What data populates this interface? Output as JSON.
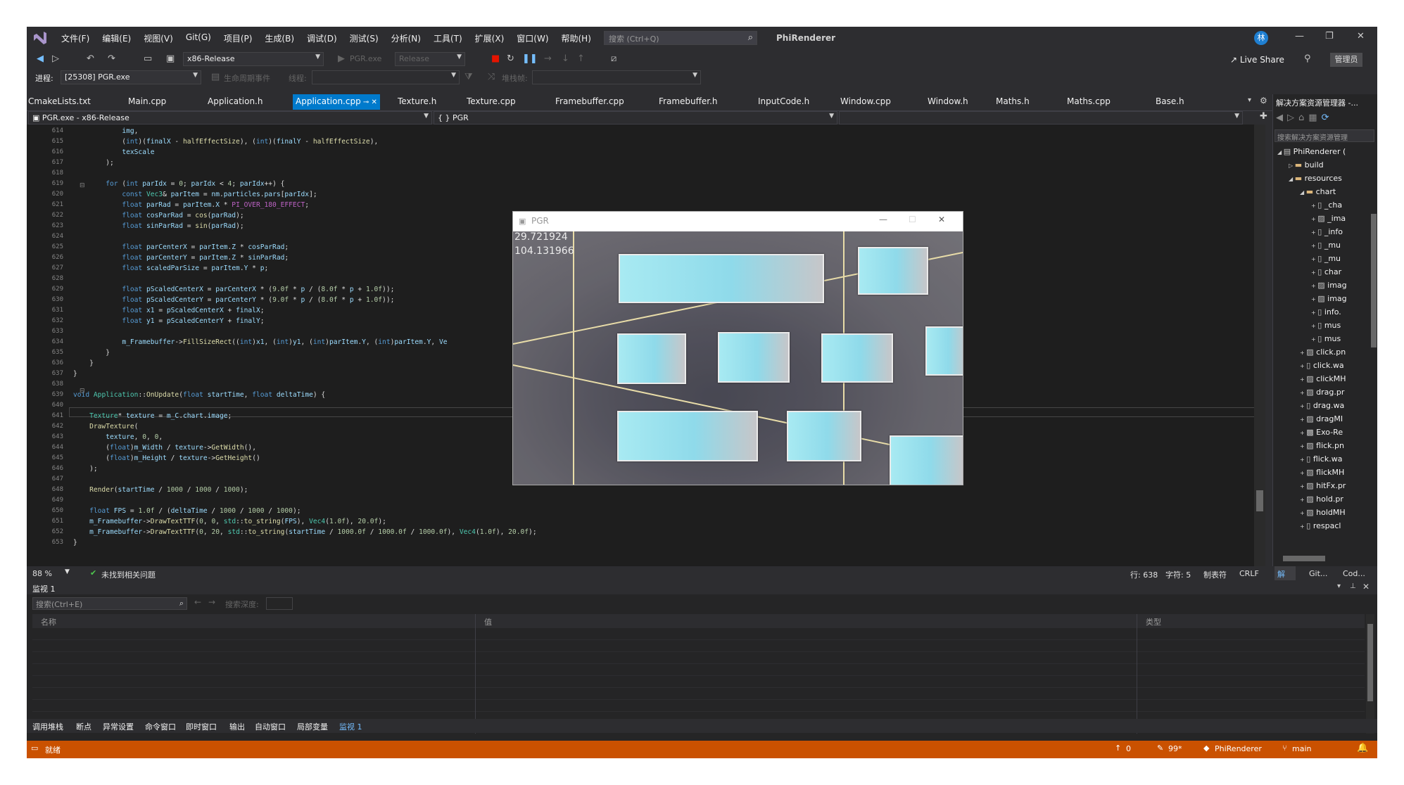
{
  "titlebar": {
    "menu": [
      "文件(F)",
      "编辑(E)",
      "视图(V)",
      "Git(G)",
      "项目(P)",
      "生成(B)",
      "调试(D)",
      "测试(S)",
      "分析(N)",
      "工具(T)",
      "扩展(X)",
      "窗口(W)",
      "帮助(H)"
    ],
    "search_placeholder": "搜索 (Ctrl+Q)",
    "solution_name": "PhiRenderer",
    "avatar_initial": "林"
  },
  "toolbar": {
    "config": "x86-Release",
    "run_target": "PGR.exe",
    "run_config": "Release",
    "live_share": "Live Share",
    "admin": "管理员",
    "process_label": "进程:",
    "process_value": "[25308] PGR.exe",
    "lifecycle_label": "生命周期事件",
    "thread_label": "线程:",
    "stackframe_label": "堆栈帧:"
  },
  "tabs": [
    "CmakeLists.txt",
    "Main.cpp",
    "Application.h",
    "Application.cpp",
    "Texture.h",
    "Texture.cpp",
    "Framebuffer.cpp",
    "Framebuffer.h",
    "InputCode.h",
    "Window.cpp",
    "Window.h",
    "Maths.h",
    "Maths.cpp",
    "Base.h"
  ],
  "active_tab": "Application.cpp",
  "navbar": {
    "project": "PGR.exe - x86-Release",
    "scope": "PGR"
  },
  "editor": {
    "line_numbers": [
      "614",
      "615",
      "616",
      "617",
      "618",
      "619",
      "620",
      "621",
      "622",
      "623",
      "624",
      "625",
      "626",
      "627",
      "628",
      "629",
      "630",
      "631",
      "632",
      "633",
      "634",
      "635",
      "636",
      "637",
      "638",
      "639",
      "640",
      "641",
      "642",
      "643",
      "644",
      "645",
      "646",
      "647",
      "648",
      "649",
      "650",
      "651",
      "652",
      "653"
    ]
  },
  "pgr_window": {
    "title": "PGR",
    "fps": "29.721924",
    "time": "104.131966"
  },
  "status_line": {
    "zoom": "88 %",
    "issues": "未找到相关问题",
    "line": "行: 638",
    "char": "字符: 5",
    "tabs": "制表符",
    "eol": "CRLF",
    "panel_tabs": [
      "解决...",
      "Git...",
      "Cod..."
    ]
  },
  "solution_explorer": {
    "title": "解决方案资源管理器 -...",
    "search_placeholder": "搜索解决方案资源管理",
    "items": [
      {
        "label": "PhiRenderer (",
        "type": "solution"
      },
      {
        "label": "build",
        "type": "folder"
      },
      {
        "label": "resources",
        "type": "folder"
      },
      {
        "label": "chart",
        "type": "folder"
      },
      {
        "label": "_cha",
        "type": "file"
      },
      {
        "label": "_ima",
        "type": "image"
      },
      {
        "label": "_info",
        "type": "file"
      },
      {
        "label": "_mu",
        "type": "file"
      },
      {
        "label": "_mu",
        "type": "file"
      },
      {
        "label": "char",
        "type": "file"
      },
      {
        "label": "imag",
        "type": "image"
      },
      {
        "label": "imag",
        "type": "image"
      },
      {
        "label": "info.",
        "type": "file"
      },
      {
        "label": "mus",
        "type": "file"
      },
      {
        "label": "mus",
        "type": "file"
      },
      {
        "label": "click.pn",
        "type": "image"
      },
      {
        "label": "click.wa",
        "type": "file"
      },
      {
        "label": "clickMH",
        "type": "image"
      },
      {
        "label": "drag.pr",
        "type": "image"
      },
      {
        "label": "drag.wa",
        "type": "file"
      },
      {
        "label": "dragMI",
        "type": "image"
      },
      {
        "label": "Exo-Re",
        "type": "font"
      },
      {
        "label": "flick.pn",
        "type": "image"
      },
      {
        "label": "flick.wa",
        "type": "file"
      },
      {
        "label": "flickMH",
        "type": "image"
      },
      {
        "label": "hitFx.pr",
        "type": "image"
      },
      {
        "label": "hold.pr",
        "type": "image"
      },
      {
        "label": "holdMH",
        "type": "image"
      },
      {
        "label": "respacl",
        "type": "file"
      }
    ]
  },
  "watch": {
    "title": "监视 1",
    "search_placeholder": "搜索(Ctrl+E)",
    "depth_label": "搜索深度:",
    "columns": [
      "名称",
      "值",
      "类型"
    ]
  },
  "bottom_tabs": [
    "调用堆栈",
    "断点",
    "异常设置",
    "命令窗口",
    "即时窗口",
    "输出",
    "自动窗口",
    "局部变量",
    "监视 1"
  ],
  "vs_status": {
    "ready": "就绪",
    "up": "0",
    "pencil": "99*",
    "repo": "PhiRenderer",
    "branch": "main"
  },
  "colors": {
    "accent": "#007acc",
    "status_debug": "#ca5100",
    "editor_bg": "#1e1e1e",
    "chrome": "#2d2d30"
  }
}
